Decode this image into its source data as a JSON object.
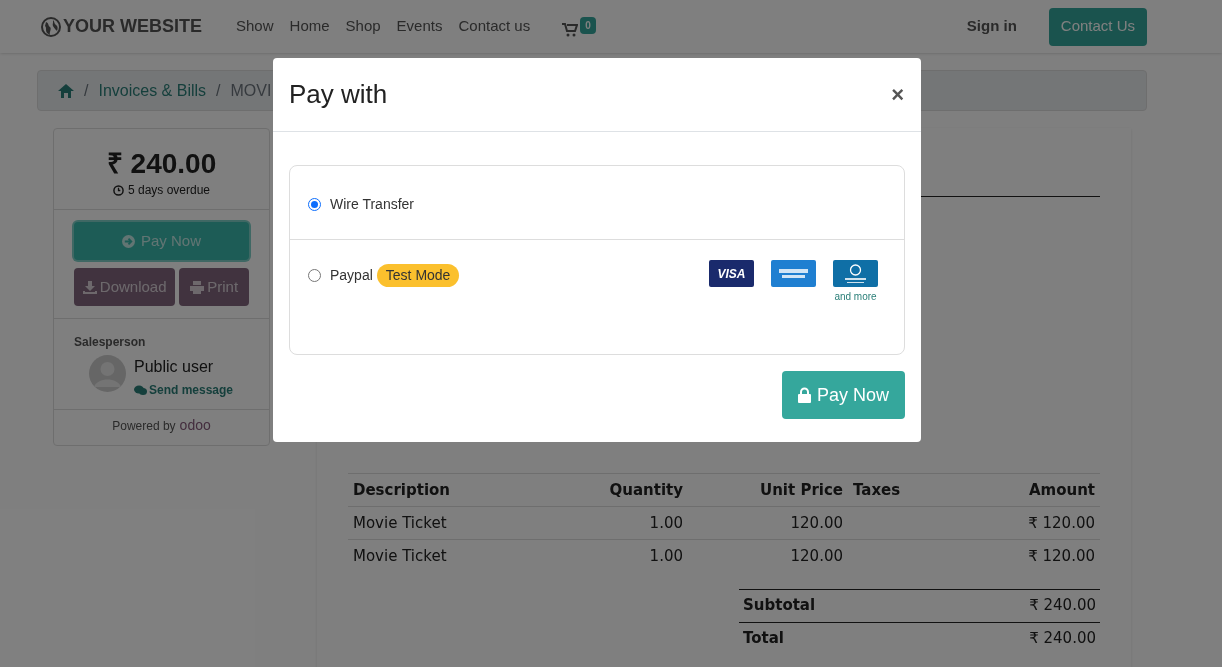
{
  "navbar": {
    "brand": "YOUR WEBSITE",
    "links": [
      "Show",
      "Home",
      "Shop",
      "Events",
      "Contact us"
    ],
    "cart_count": "0",
    "sign_in": "Sign in",
    "contact_button": "Contact Us"
  },
  "breadcrumb": {
    "items": [
      {
        "separator": "/",
        "label": "Invoices & Bills"
      },
      {
        "separator": "/",
        "label": "MOVI"
      }
    ]
  },
  "sidebar": {
    "amount": "₹ 240.00",
    "overdue": "5 days overdue",
    "pay_now": "Pay Now",
    "download": "Download",
    "print": "Print",
    "salesperson_label": "Salesperson",
    "salesperson_name": "Public user",
    "send_message": "Send message",
    "powered_by": "Powered by",
    "powered_logo": "odoo"
  },
  "invoice": {
    "columns": [
      "Description",
      "Quantity",
      "Unit Price",
      "Taxes",
      "Amount"
    ],
    "rows": [
      [
        "Movie Ticket",
        "1.00",
        "120.00",
        "",
        "₹ 120.00"
      ],
      [
        "Movie Ticket",
        "1.00",
        "120.00",
        "",
        "₹ 120.00"
      ]
    ],
    "subtotal": {
      "label": "Subtotal",
      "value": "₹ 240.00"
    },
    "total": {
      "label": "Total",
      "value": "₹ 240.00"
    }
  },
  "modal": {
    "title": "Pay with",
    "close": "×",
    "options": [
      {
        "label": "Wire Transfer",
        "selected": true
      },
      {
        "label": "Paypal",
        "selected": false,
        "badge": "Test Mode",
        "cards": true
      }
    ],
    "visa": "VISA",
    "and_more": "and more",
    "pay_button": "Pay Now"
  }
}
